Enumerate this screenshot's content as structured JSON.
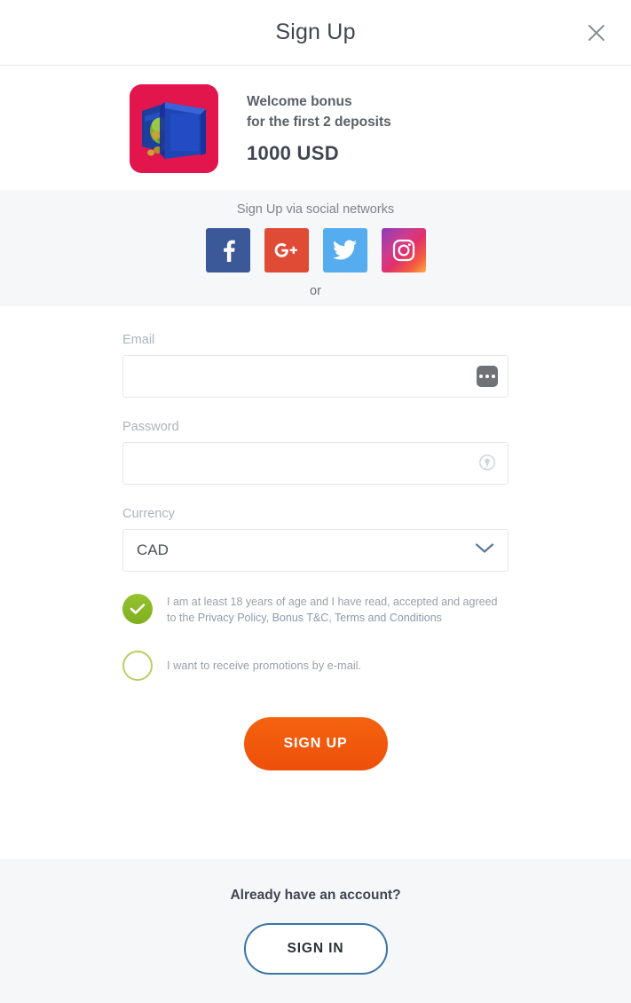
{
  "header": {
    "title": "Sign Up",
    "close_icon": "close-icon"
  },
  "bonus": {
    "icon": "safe-vault-icon",
    "line1": "Welcome bonus",
    "line2": "for the first 2 deposits",
    "amount": "1000 USD",
    "icon_bg": "#e2154d"
  },
  "social": {
    "title": "Sign Up via social networks",
    "or_label": "or",
    "networks": [
      {
        "name": "facebook",
        "label": "f",
        "color": "#3b5998"
      },
      {
        "name": "google-plus",
        "label": "G+",
        "color": "#e04b35"
      },
      {
        "name": "twitter",
        "label": "twitter-bird",
        "color": "#55acee"
      },
      {
        "name": "instagram",
        "label": "instagram-camera",
        "color": "#e1306c"
      }
    ]
  },
  "form": {
    "email": {
      "label": "Email",
      "value": "",
      "placeholder": "",
      "icon": "autofill-dots-icon"
    },
    "password": {
      "label": "Password",
      "value": "",
      "placeholder": "",
      "icon": "key-icon"
    },
    "currency": {
      "label": "Currency",
      "value": "CAD",
      "chevron_icon": "chevron-down-icon",
      "chevron_color": "#5b7a99"
    },
    "terms": {
      "checked": true,
      "text_before": "I am at least 18 years of age and I have read, accepted and agreed to the ",
      "link_privacy": "Privacy Policy",
      "sep1": ", ",
      "link_bonus": "Bonus T&C",
      "sep2": ", ",
      "link_terms": "Terms and Conditions",
      "check_color": "#8bbb28"
    },
    "promotions": {
      "checked": false,
      "text": "I want to receive promotions by e-mail.",
      "outline_color": "#b7cf63"
    },
    "submit_label": "SIGN UP",
    "submit_color": "#f1580c"
  },
  "footer": {
    "prompt": "Already have an account?",
    "signin_label": "SIGN IN",
    "signin_border_color": "#3a74a8"
  }
}
